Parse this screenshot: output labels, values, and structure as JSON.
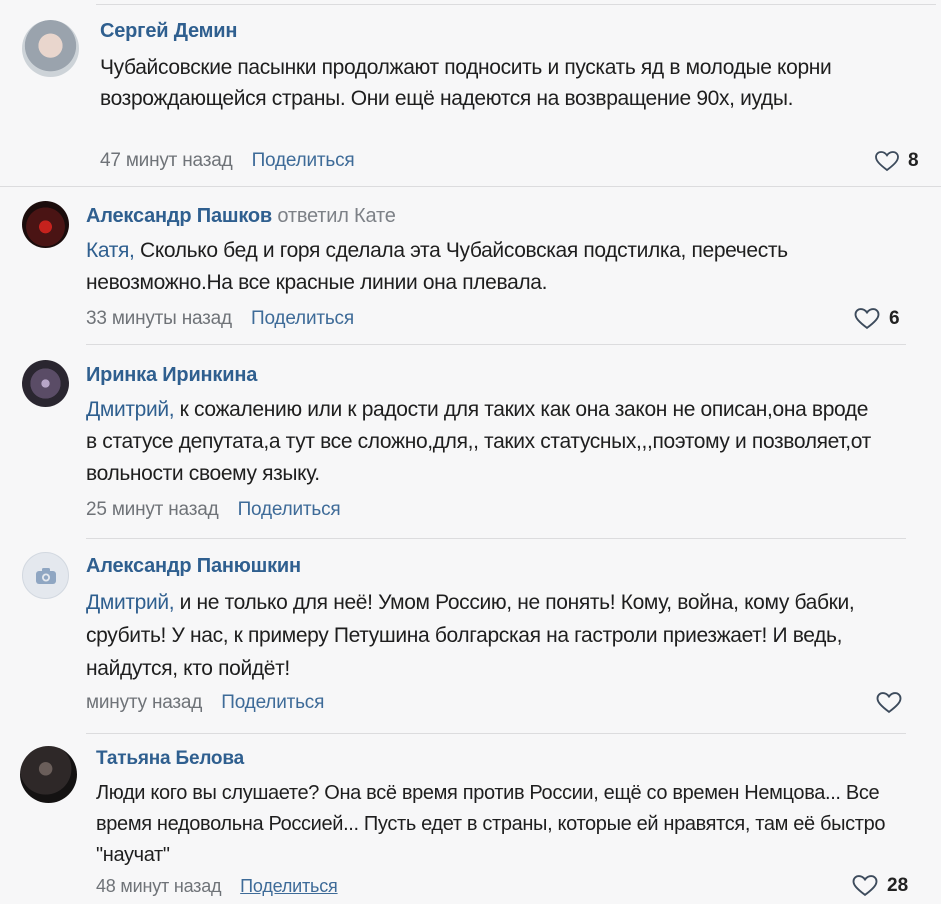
{
  "comments": [
    {
      "author": "Сергей Демин",
      "reply_to": "",
      "mention": "",
      "text": "Чубайсовские пасынки продолжают подносить и пускать яд в молодые корни возрождающейся страны. Они ещё надеются на возвращение 90х, иуды.",
      "time": "47 минут назад",
      "share_label": "Поделиться",
      "likes": "8"
    },
    {
      "author": "Александр Пашков",
      "reply_to": "ответил Кате",
      "mention": "Катя,",
      "text": " Сколько бед и горя сделала эта Чубайсовская подстилка, перечесть невозможно.На все красные линии она плевала.",
      "time": "33 минуты назад",
      "share_label": "Поделиться",
      "likes": "6"
    },
    {
      "author": "Иринка Иринкина",
      "reply_to": "",
      "mention": "Дмитрий,",
      "text": " к сожалению или к радости для таких как она закон не описан,она вроде в статусе депутата,а тут все сложно,для,, таких статусных,,,поэтому и позволяет,от вольности своему языку.",
      "time": "25 минут назад",
      "share_label": "Поделиться",
      "likes": ""
    },
    {
      "author": "Александр Панюшкин",
      "reply_to": "",
      "mention": "Дмитрий,",
      "text": " и не только для неё! Умом Россию, не понять! Кому, война, кому бабки, срубить! У нас, к примеру Петушина болгарская на гастроли приезжает! И ведь, найдутся, кто пойдёт!",
      "time": "минуту назад",
      "share_label": "Поделиться",
      "likes": ""
    },
    {
      "author": "Татьяна Белова",
      "reply_to": "",
      "mention": "",
      "text": "Люди кого вы слушаете? Она всё время против России, ещё со времен Немцова... Все время недовольна Россией... Пусть едет в страны, которые ей нравятся, там её быстро \"научат\"",
      "time": "48 минут назад",
      "share_label": "Поделиться",
      "likes": "28"
    }
  ],
  "icons": {
    "like": "heart-outline-icon",
    "placeholder_avatar": "camera-icon"
  },
  "colors": {
    "author": "#2f5f8f",
    "share": "#3e6b98",
    "meta": "#6f7378",
    "divider": "#dcdcde",
    "background": "#f7f7f8"
  }
}
